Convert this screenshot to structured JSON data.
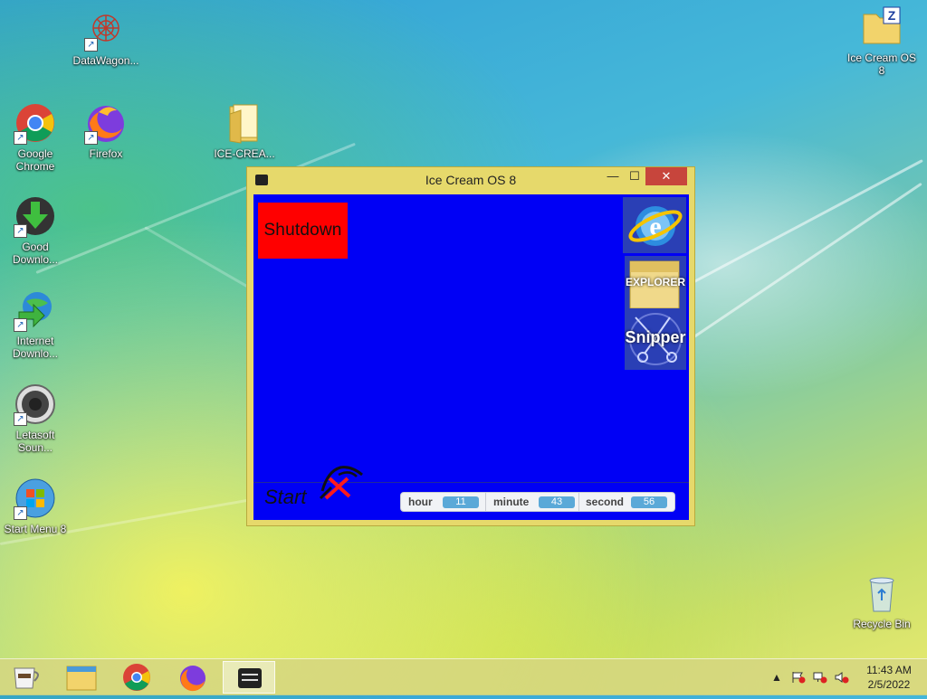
{
  "desktop": {
    "icons": [
      {
        "label": "DataWagon..."
      },
      {
        "label": "Google Chrome"
      },
      {
        "label": "Firefox"
      },
      {
        "label": "ICE-CREA..."
      },
      {
        "label": "Good Downlo..."
      },
      {
        "label": "Internet Downlo..."
      },
      {
        "label": "Letasoft Soun..."
      },
      {
        "label": "Start Menu 8"
      },
      {
        "label": "Ice Cream OS 8"
      },
      {
        "label": "Recycle Bin"
      }
    ]
  },
  "window": {
    "title": "Ice Cream OS 8",
    "min_symbol": "—",
    "max_symbol": "☐",
    "close_symbol": "✕"
  },
  "app": {
    "shutdown_label": "Shutdown",
    "explorer_label": "EXPLORER",
    "snipper_label": "Snipper",
    "start_label": "Start",
    "clock": {
      "hour_label": "hour",
      "hour_value": "11",
      "minute_label": "minute",
      "minute_value": "43",
      "second_label": "second",
      "second_value": "56"
    }
  },
  "taskbar": {
    "time": "11:43 AM",
    "date": "2/5/2022",
    "tray_chevron": "▲"
  },
  "colors": {
    "client_bg": "#0000f5",
    "shutdown_bg": "#ff0000",
    "window_frame": "#e6d96b",
    "close_button": "#c7453c"
  }
}
